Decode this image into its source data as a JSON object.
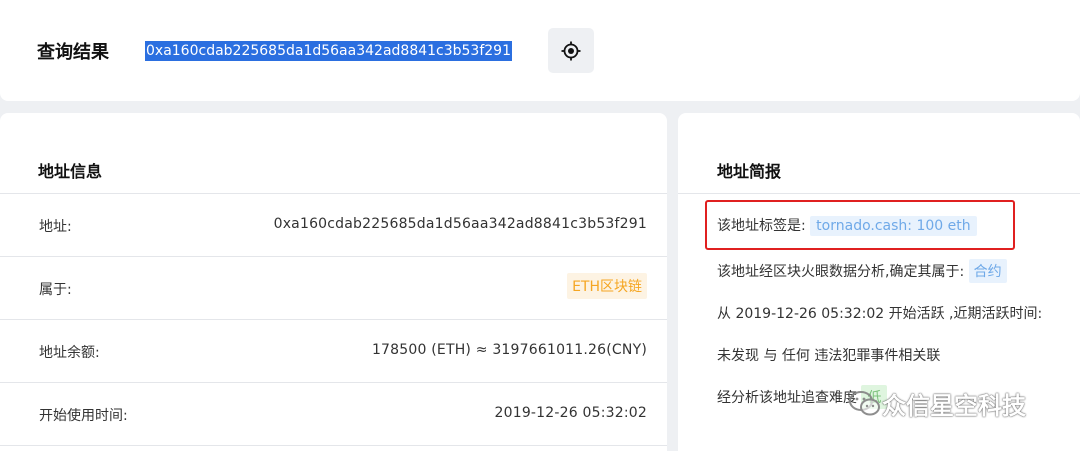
{
  "header": {
    "title": "查询结果",
    "address": "0xa160cdab225685da1d56aa342ad8841c3b53f291"
  },
  "address_info": {
    "title": "地址信息",
    "rows": [
      {
        "label": "地址:",
        "value": "0xa160cdab225685da1d56aa342ad8841c3b53f291"
      },
      {
        "label": "属于:",
        "value": "ETH区块链"
      },
      {
        "label": "地址余额:",
        "value": "178500 (ETH) ≈ 3197661011.26(CNY)"
      },
      {
        "label": "开始使用时间:",
        "value": "2019-12-26 05:32:02"
      }
    ]
  },
  "brief": {
    "title": "地址简报",
    "line1_prefix": "该地址标签是:",
    "line1_tag": "tornado.cash: 100 eth",
    "line2_prefix": "该地址经区块火眼数据分析,确定其属于:",
    "line2_tag": "合约",
    "line3": "从 2019-12-26 05:32:02 开始活跃 ,近期活跃时间:",
    "line4": "未发现 与 任何 违法犯罪事件相关联",
    "line5_prefix": "经分析该地址追查难度",
    "line5_tag": "低"
  },
  "watermark": {
    "text": "众信星空科技"
  },
  "colors": {
    "selection": "#2b6fe0",
    "chain_badge": "#f5a623",
    "tag_blue": "#6fa9e8",
    "highlight_box": "#e02020"
  },
  "icons": {
    "locate": "crosshair-icon",
    "watermark": "wechat-icon"
  }
}
